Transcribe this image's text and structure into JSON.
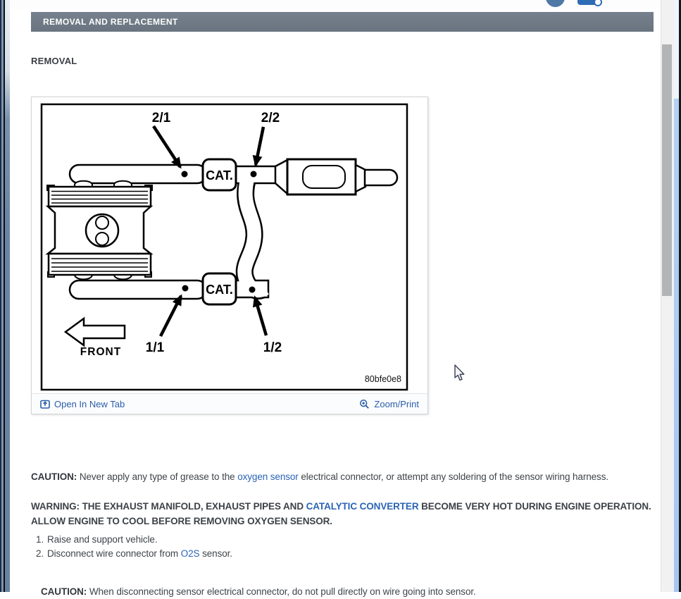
{
  "topbar": {
    "avatar_icon": "user-avatar-icon",
    "print_icon": "printer-icon"
  },
  "header": {
    "title": "REMOVAL AND REPLACEMENT"
  },
  "section": {
    "heading": "REMOVAL"
  },
  "figure": {
    "callouts": {
      "c21": "2/1",
      "c22": "2/2",
      "c11": "1/1",
      "c12": "1/2"
    },
    "cat_label": "CAT.",
    "front_label": "FRONT",
    "figure_code": "80bfe0e8",
    "open_link": "Open In New Tab",
    "zoom_link": "Zoom/Print"
  },
  "caution1": {
    "label": "CAUTION:",
    "pre": " Never apply any type of grease to the ",
    "link": "oxygen sensor",
    "post": " electrical connector, or attempt any soldering of the sensor wiring harness."
  },
  "warning": {
    "pre": "WARNING: THE EXHAUST MANIFOLD, EXHAUST PIPES AND ",
    "link": "CATALYTIC CONVERTER",
    "post": " BECOME VERY HOT DURING ENGINE OPERATION. ALLOW ENGINE TO COOL BEFORE REMOVING OXYGEN SENSOR."
  },
  "steps": [
    {
      "num": "1.",
      "pre": "Raise and support vehicle.",
      "link": "",
      "post": ""
    },
    {
      "num": "2.",
      "pre": "Disconnect wire connector from ",
      "link": "O2S",
      "post": " sensor."
    }
  ],
  "caution2": {
    "label": "CAUTION:",
    "text": " When disconnecting sensor electrical connector, do not pull directly on wire going into sensor."
  },
  "colors": {
    "link": "#2a64b5",
    "header_bar": "#6e7987",
    "scroll_thumb": "#b2b4b6"
  }
}
